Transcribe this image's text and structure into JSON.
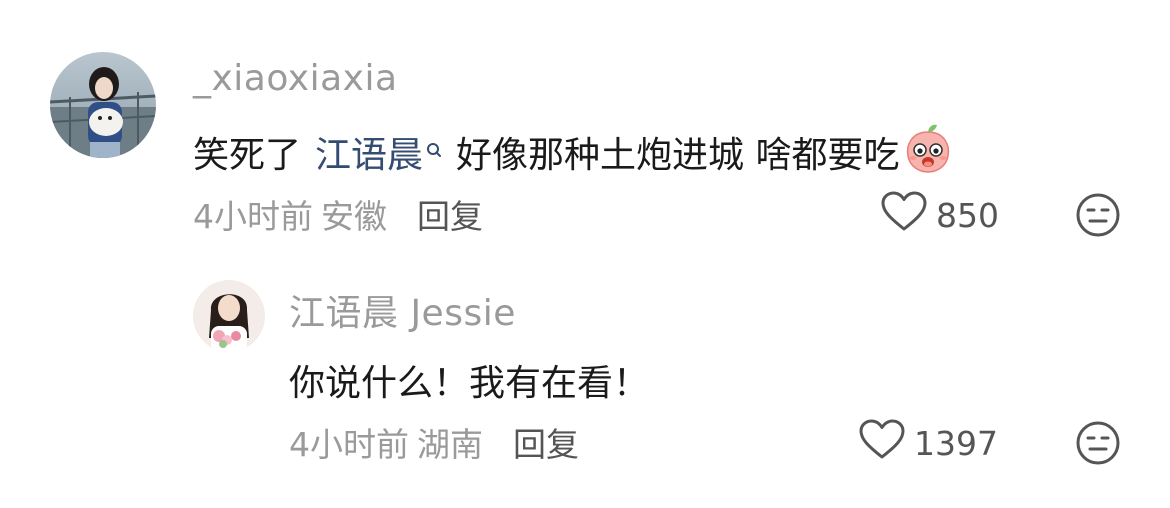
{
  "comments": [
    {
      "username": "_xiaoxiaxia",
      "text_before": "笑死了 ",
      "mention": "江语晨",
      "text_after": "好像那种土炮进城 啥都要吃",
      "emoji": "peach-face-emoji",
      "time": "4小时前",
      "location": "安徽",
      "reply_label": "回复",
      "likes": "850"
    },
    {
      "username": "江语晨 Jessie",
      "text": "你说什么！我有在看！",
      "time": "4小时前",
      "location": "湖南",
      "reply_label": "回复",
      "likes": "1397"
    }
  ],
  "icons": {
    "like": "heart-outline-icon",
    "dislike": "neutral-face-icon",
    "mention_search": "search-icon"
  },
  "colors": {
    "mention": "#344b72",
    "meta": "#9a9a9a",
    "text": "#1a1a1a"
  }
}
